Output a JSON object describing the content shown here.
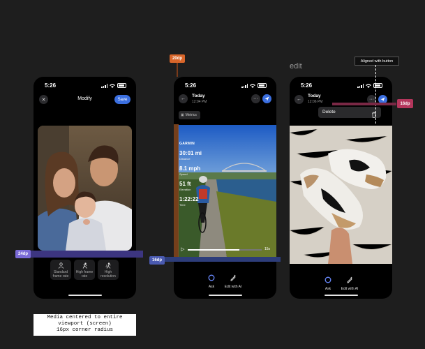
{
  "colors": {
    "canvas": "#1e1e1e",
    "accent_blue": "#3b6fe0",
    "annotation_purple": "#4a3ea8",
    "annotation_orange": "#d9662a",
    "annotation_red": "#b4365c"
  },
  "phone1": {
    "time": "5:26",
    "title": "Modify",
    "save_label": "Save",
    "close_icon": "close-icon",
    "modes": [
      {
        "label_line1": "Standard",
        "label_line2": "frame rate",
        "icon": "person-icon"
      },
      {
        "label_line1": "High frame",
        "label_line2": "rate",
        "icon": "runner-icon"
      },
      {
        "label_line1": "High",
        "label_line2": "resolution",
        "icon": "person-motion-icon"
      }
    ]
  },
  "phone2": {
    "time": "5:26",
    "day": "Today",
    "clock": "12:04 PM",
    "metrics_label": "Metrics",
    "garmin": "GARMIN",
    "stats": [
      {
        "value": "30:01 mi",
        "label": "Distance"
      },
      {
        "value": "8.1 mph",
        "label": "Speed"
      },
      {
        "value": "51 ft",
        "label": "Elevation"
      },
      {
        "value": "1:22:22",
        "label": "Time"
      }
    ],
    "video_duration": "15s",
    "video_progress": 0.7,
    "ask_label": "Ask",
    "edit_label": "Edit with AI"
  },
  "phone3": {
    "time": "5:26",
    "day": "Today",
    "clock": "12:06 PM",
    "menu_item": "Delete",
    "ask_label": "Ask",
    "edit_label": "Edit with AI"
  },
  "annotations": {
    "edit_heading": "edit",
    "aligned_note": "Aligned with button",
    "tag_20dp": "20dp",
    "tag_24dp": "24dp",
    "tag_16dp_left": "16dp",
    "tag_16dp_right": "16dp",
    "note_lines": [
      "Media centered to entire",
      "viewport (screen)",
      "16px corner radius"
    ]
  }
}
